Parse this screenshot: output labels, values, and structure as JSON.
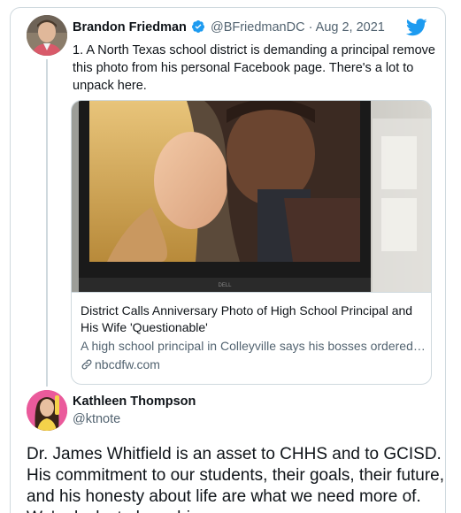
{
  "tweet": {
    "author_name": "Brandon Friedman",
    "author_handle": "@BFriedmanDC",
    "separator": "·",
    "date": "Aug 2, 2021",
    "text": "1. A North Texas school district is demanding a principal remove this photo from his personal Facebook page. There's a lot to unpack here.",
    "link_card": {
      "title": "District Calls Anniversary Photo of High School Principal and His Wife 'Questionable'",
      "description": "A high school principal in Colleyville says his bosses ordered…",
      "domain": "nbcdfw.com"
    }
  },
  "reply": {
    "author_name": "Kathleen Thompson",
    "author_handle": "@ktnote",
    "text": "Dr. James Whitfield is an asset to CHHS and to GCISD. His commitment to our students, their goals, their future, and his honesty about life are what we need more of. We're lucky to have him."
  },
  "icons": {
    "brand": "twitter-bird-icon",
    "verified": "verified-badge-icon",
    "link": "link-icon"
  },
  "colors": {
    "brand_blue": "#1d9bf0",
    "secondary_text": "#536471",
    "border": "#cfd9de"
  }
}
